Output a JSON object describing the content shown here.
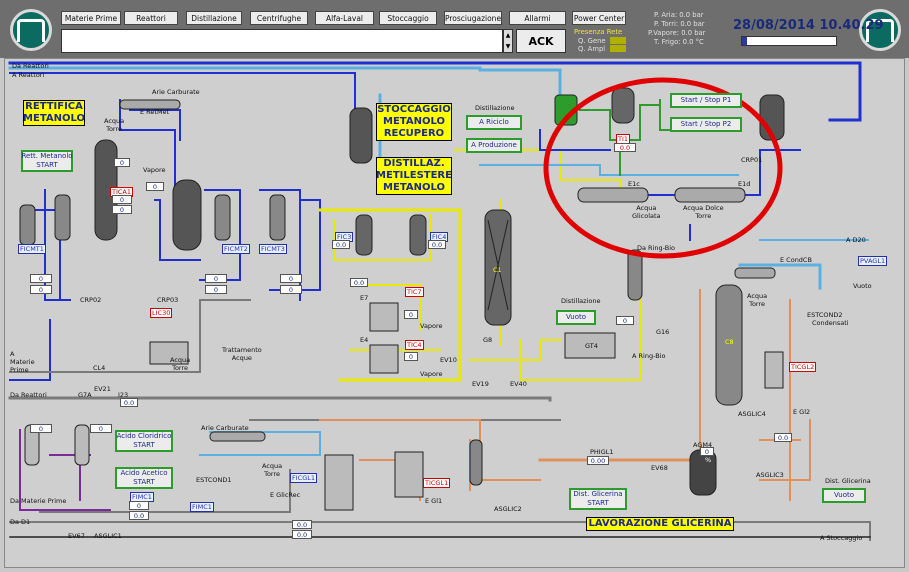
{
  "nav": {
    "materie_prime": "Materie Prime",
    "reattori": "Reattori",
    "distillazione": "Distillazione",
    "centrifughe": "Centrifughe",
    "alfa_laval": "Alfa-Laval",
    "stoccaggio": "Stoccaggio",
    "prosciugazione": "Prosciugazione",
    "allarmi": "Allarmi",
    "power_center": "Power Center"
  },
  "ack_label": "ACK",
  "status": {
    "presenza_rete": "Presenza Rete",
    "q_gene": "Q. Gene",
    "q_ampl": "Q. Ampl",
    "p_aria": "P. Aria: 0.0 bar",
    "p_torri": "P. Torri: 0.0 bar",
    "p_vapore": "P.Vapore: 0.0 bar",
    "t_frigo": "T. Frigo: 0.0 °C"
  },
  "datetime": "28/08/2014 10.40.29",
  "progress_fraction": 0.05,
  "colors": {
    "blue_pipe": "#2030d0",
    "yellow_pipe": "#e8e800",
    "green_pipe": "#2c9c2c",
    "orange_pipe": "#e0905a",
    "gray_pipe": "#7a7a7a",
    "purple_pipe": "#7a2a9a",
    "alert_circle": "#e00000"
  },
  "sections": {
    "rettifica": "RETTIFICA\nMETANOLO",
    "stoccaggio": "STOCCAGGIO\nMETANOLO\nRECUPERO",
    "distillaz": "DISTILLAZ.\nMETILESTERE\nMETANOLO",
    "glicerina": "LAVORAZIONE GLICERINA"
  },
  "buttons": {
    "rett_metanolo": "Rett. Metanolo\nSTART",
    "a_riciclo": "A Riciclo",
    "a_produzione": "A Produzione",
    "start_stop_p1": "Start / Stop P1",
    "start_stop_p2": "Start / Stop P2",
    "vuoto_dist": "Vuoto",
    "acido_cloridrico": "Acido Cloridrico\nSTART",
    "acido_acetico": "Acido Acetico\nSTART",
    "dist_glicerina": "Dist. Glicerina\nSTART",
    "vuoto_glic": "Vuoto"
  },
  "labels": {
    "da_reattori_1": "Da Reattori",
    "a_reattori": "A Reattori",
    "arie_carburate_1": "Arie Carburate",
    "e_retmet": "E RetMet",
    "acqua_torre_1": "Acqua\nTorre",
    "vapore": "Vapore",
    "distillazione_1": "Distillazione",
    "e1c": "E1c",
    "e1d": "E1d",
    "acqua_glicolata": "Acqua\nGlicolata",
    "acqua_dolce_torre": "Acqua Dolce\nTorre",
    "da_ring_bio": "Da Ring-Bio",
    "a_ring_bio": "A Ring-Bio",
    "distillazione_2": "Distillazione",
    "a_d20": "A D20",
    "e_condcb": "E CondCB",
    "acqua_torre_2": "Acqua\nTorre",
    "vuoto_lbl": "Vuoto",
    "condensati": "Condensati",
    "trattamento_acque": "Trattamento\nAcque",
    "acqua_torre_3": "Acqua\nTorre",
    "a_materie_prime": "A\nMaterie\nPrime",
    "da_reattori_2": "Da Reattori",
    "arie_carburate_2": "Arie Carburate",
    "acqua_torre_4": "Acqua\nTorre",
    "e_glicrec": "E GlicRec",
    "e_gl1": "E Gl1",
    "e_gl2": "E Gl2",
    "da_materie_prime": "Da Materie Prime",
    "da_d1": "Da D1",
    "a_stoccaggio": "A Stoccaggio",
    "dist_glicerina_lbl": "Dist. Glicerina",
    "vapore_e7": "Vapore",
    "vapore_e4": "Vapore",
    "e7": "E7",
    "e4": "E4"
  },
  "tags": {
    "tic30": "TICA1",
    "tic30b": "LIC30",
    "tic7": "TIC7",
    "tic4": "TIC4",
    "ticgl1": "TICGL1",
    "ticgl2": "TICGL2",
    "ti1": "TI1",
    "ficmt1": "FICMT1",
    "ficmt2": "FICMT2",
    "ficmt3": "FICMT3",
    "fic3": "FIC3",
    "fic4": "FIC4",
    "ficgl1": "FICGL1",
    "fimc1": "FIMC1",
    "fimc2": "FIMC1",
    "pvagl1": "PVAGL1",
    "estcond1": "ESTCOND1",
    "estcond2": "ESTCOND2",
    "crp02": "CRP02",
    "crp03": "CRP03",
    "crp01": "CRP01",
    "asglic1": "ASGLIC1",
    "asglic2": "ASGLIC2",
    "asglic3": "ASGLIC3",
    "asglic4": "ASGLIC4",
    "phigl1": "PHIGL1",
    "c1": "C1",
    "c8": "C8",
    "gt4": "GT4",
    "agm4": "AGM4",
    "ev10": "EV10",
    "ev19": "EV19",
    "ev40": "EV40",
    "ev68": "EV68",
    "ev67": "EV67",
    "ev21": "EV21",
    "cl4": "CL4",
    "g7a": "G7A",
    "i23": "I23",
    "g16": "G16",
    "g8": "G8"
  },
  "values": {
    "zero": "0",
    "zero_dec": "0.0",
    "zero_dec2": "0.00",
    "pct": "%"
  }
}
